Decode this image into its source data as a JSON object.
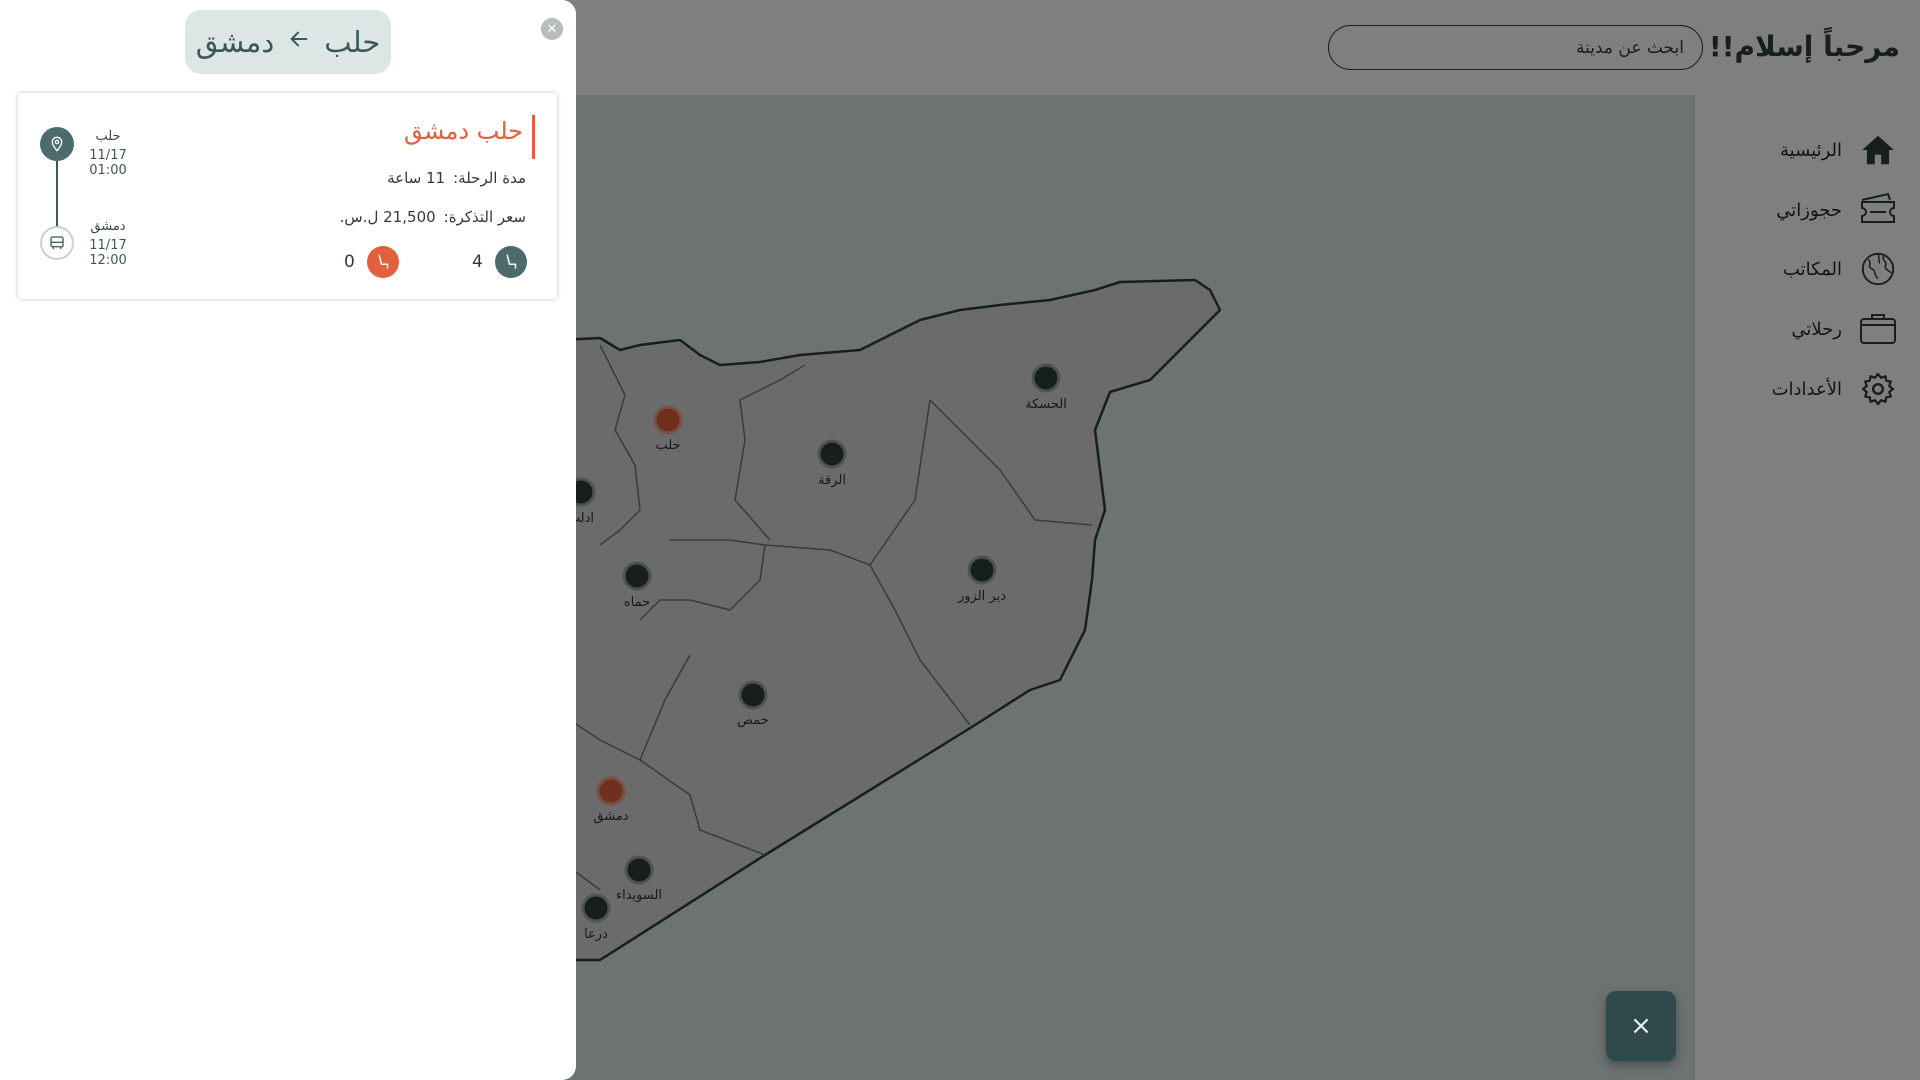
{
  "header": {
    "greeting": "مرحباً إسلام!!",
    "wave_icon": "waving-hand-icon",
    "search_placeholder": "ابحث عن مدينة"
  },
  "sidebar": {
    "items": [
      {
        "label": "الرئيسية",
        "icon": "home-icon"
      },
      {
        "label": "حجوزاتي",
        "icon": "ticket-icon"
      },
      {
        "label": "المكاتب",
        "icon": "globe-icon"
      },
      {
        "label": "رحلاتي",
        "icon": "suitcase-icon"
      },
      {
        "label": "الأعدادات",
        "icon": "gear-icon"
      }
    ]
  },
  "map": {
    "cities": [
      {
        "name": "الحسكة",
        "highlighted": false
      },
      {
        "name": "حلب",
        "highlighted": true
      },
      {
        "name": "الرقة",
        "highlighted": false
      },
      {
        "name": "ادلب",
        "highlighted": false
      },
      {
        "name": "دير الزور",
        "highlighted": false
      },
      {
        "name": "حماه",
        "highlighted": false
      },
      {
        "name": "حمص",
        "highlighted": false
      },
      {
        "name": "دمشق",
        "highlighted": true
      },
      {
        "name": "السويداء",
        "highlighted": false
      },
      {
        "name": "درعا",
        "highlighted": false
      }
    ]
  },
  "drawer": {
    "route_from": "حلب",
    "route_to": "دمشق",
    "close_icon": "close-icon",
    "trip": {
      "title": "حلب دمشق",
      "duration_label": "مدة الرحلة:",
      "duration_value": "11 ساعة",
      "price_label": "سعر التذكرة:",
      "price_value": "21,500 ل.س.",
      "seats_available": "4",
      "seats_booked": "0",
      "departure_city": "حلب",
      "departure_time": "11/17 01:00",
      "arrival_city": "دمشق",
      "arrival_time": "11/17 12:00"
    }
  },
  "fab": {
    "label": "×"
  },
  "colors": {
    "accent": "#e2603c",
    "primary": "#3d5858",
    "map_fill": "#dbe7e4",
    "land_fill": "#d6d6d6"
  }
}
